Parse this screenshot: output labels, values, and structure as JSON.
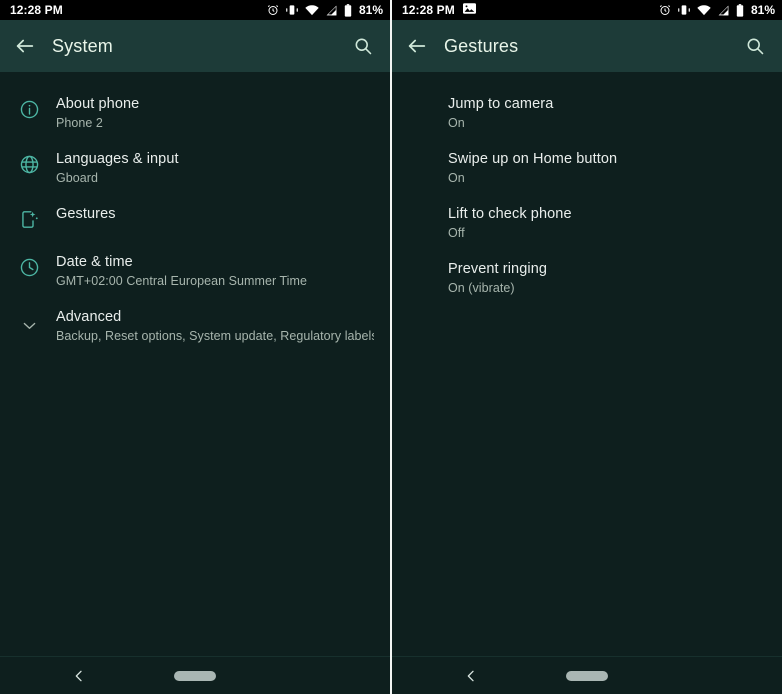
{
  "colors": {
    "status_bar_bg": "#000000",
    "app_bar_bg": "#1d3b38",
    "content_bg": "#0e1f1e",
    "title_text": "#e8f5e9",
    "primary_text": "#e9eeec",
    "secondary_text": "#a7b5ad",
    "icon_accent": "#4db6a4",
    "divider": "#f2f5f3",
    "nav_pill": "#a9b6b3"
  },
  "status_bar": {
    "time": "12:28 PM",
    "battery_percent": "81%",
    "left_icons_left_panel": [],
    "left_icons_right_panel": [
      "screenshot-icon"
    ],
    "right_icons": [
      "alarm-icon",
      "vibrate-icon",
      "wifi-icon",
      "signal-icon",
      "battery-icon"
    ]
  },
  "left_panel": {
    "app_bar": {
      "back_icon": "arrow-left-icon",
      "title": "System",
      "search_icon": "search-icon"
    },
    "items": [
      {
        "icon": "info-icon",
        "title": "About phone",
        "subtitle": "Phone 2"
      },
      {
        "icon": "globe-icon",
        "title": "Languages & input",
        "subtitle": "Gboard"
      },
      {
        "icon": "gestures-icon",
        "title": "Gestures",
        "subtitle": ""
      },
      {
        "icon": "clock-icon",
        "title": "Date & time",
        "subtitle": "GMT+02:00 Central European Summer Time"
      },
      {
        "icon": "chevron-down-icon",
        "title": "Advanced",
        "subtitle": "Backup, Reset options, System update, Regulatory labels, Raz.."
      }
    ]
  },
  "right_panel": {
    "app_bar": {
      "back_icon": "arrow-left-icon",
      "title": "Gestures",
      "search_icon": "search-icon"
    },
    "items": [
      {
        "icon": "",
        "title": "Jump to camera",
        "subtitle": "On"
      },
      {
        "icon": "",
        "title": "Swipe up on Home button",
        "subtitle": "On"
      },
      {
        "icon": "",
        "title": "Lift to check phone",
        "subtitle": "Off"
      },
      {
        "icon": "",
        "title": "Prevent ringing",
        "subtitle": "On (vibrate)"
      }
    ]
  },
  "nav_bar": {
    "back_icon": "nav-back-icon",
    "home_pill": "home-gesture-pill"
  }
}
